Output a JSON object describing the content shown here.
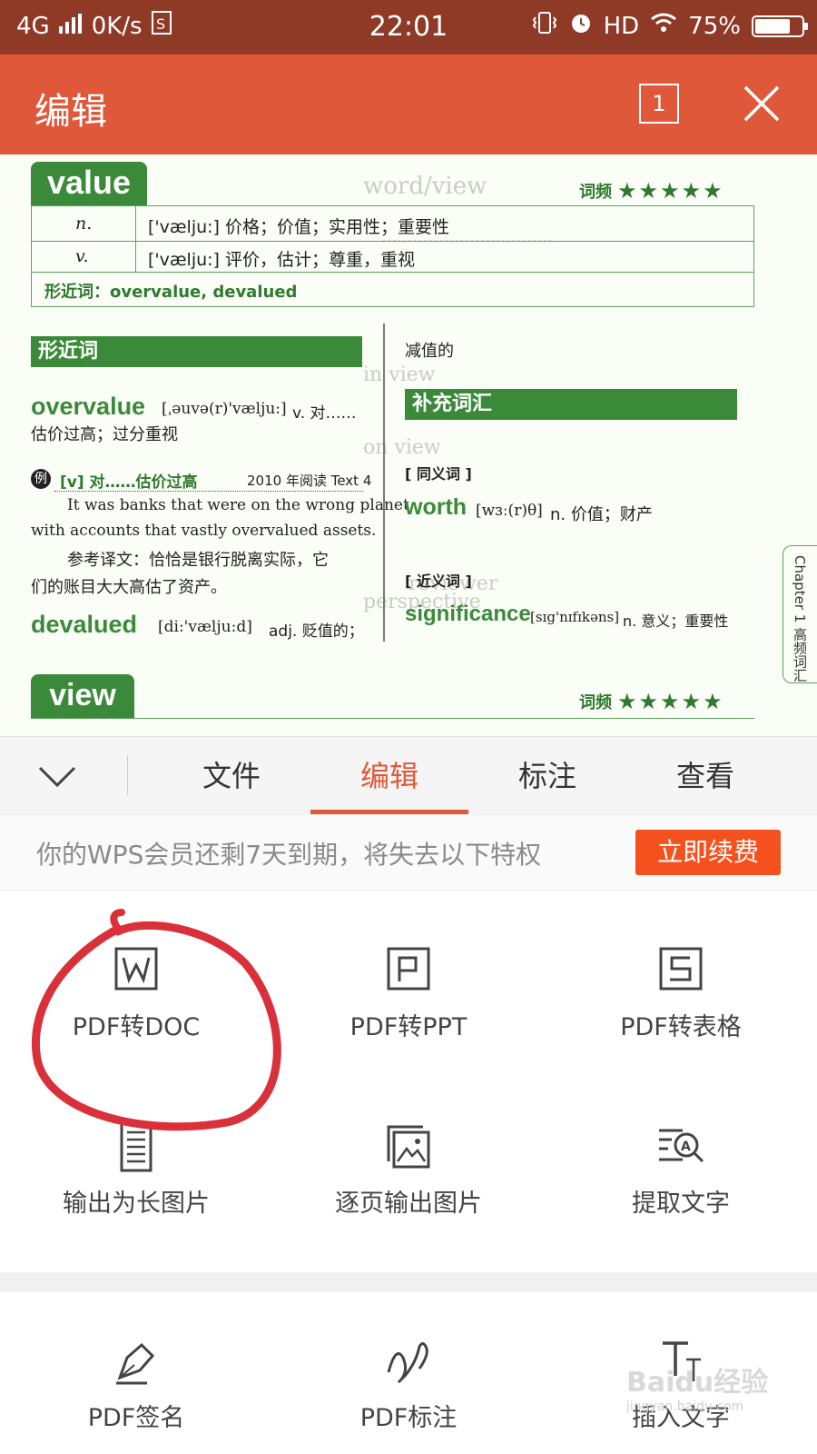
{
  "status_bar": {
    "network": "4G",
    "speed": "0K/s",
    "time": "22:01",
    "hd": "HD",
    "battery": "75%",
    "battery_level": 0.75
  },
  "app_bar": {
    "title": "编辑",
    "page_indicator": "1"
  },
  "document": {
    "entry1": {
      "word": "value",
      "frequency_label": "词频",
      "stars": "★★★★★",
      "senses": [
        {
          "pos": "n.",
          "text": "['vælju:] 价格；价值；实用性；重要性"
        },
        {
          "pos": "v.",
          "text": "['vælju:] 评价，估计；尊重，重视"
        }
      ],
      "similar_line": "形近词：overvalue, devalued"
    },
    "left_col": {
      "section_title": "形近词",
      "overvalue_word": "overvalue",
      "overvalue_phon": "[ˌəuvə(r)'vælju:]",
      "overvalue_pos": "v. 对……",
      "overvalue_def": "估价过高；过分重视",
      "example_badge": "例",
      "example_tag": "[v] 对……估价过高",
      "example_source": "2010 年阅读 Text 4",
      "example_en_1": "It was banks that were on the wrong planet,",
      "example_en_2": "with accounts that vastly overvalued assets.",
      "example_cn_1": "参考译文：恰恰是银行脱离实际，它",
      "example_cn_2": "们的账目大大高估了资产。",
      "devalued_word": "devalued",
      "devalued_phon": "[di:'vælju:d]",
      "devalued_pos": "adj. 贬值的；"
    },
    "right_col": {
      "cont": "减值的",
      "section_title": "补充词汇",
      "syn_label": "[ 同义词 ]",
      "worth_word": "worth",
      "worth_phon": "[wɜː(r)θ]",
      "worth_def": "n. 价值；财产",
      "near_label": "[ 近义词 ]",
      "sig_word": "significance",
      "sig_phon": "[sɪg'nɪfɪkəns]",
      "sig_def": "n. 意义；重要性"
    },
    "entry2": {
      "word": "view",
      "frequency_label": "词频",
      "stars": "★★★★★"
    },
    "chapter_tab": "Chapter 1 高频词汇"
  },
  "bottom_sheet": {
    "tabs": [
      {
        "label": "文件"
      },
      {
        "label": "编辑"
      },
      {
        "label": "标注"
      },
      {
        "label": "查看"
      }
    ],
    "promo": {
      "message": "你的WPS会员还剩7天到期，将失去以下特权",
      "button": "立即续费"
    },
    "tools": [
      {
        "label": "PDF转DOC",
        "icon": "word-doc-icon"
      },
      {
        "label": "PDF转PPT",
        "icon": "ppt-icon"
      },
      {
        "label": "PDF转表格",
        "icon": "sheet-icon"
      },
      {
        "label": "输出为长图片",
        "icon": "long-image-icon"
      },
      {
        "label": "逐页输出图片",
        "icon": "pages-image-icon"
      },
      {
        "label": "提取文字",
        "icon": "extract-text-icon"
      },
      {
        "label": "PDF签名",
        "icon": "pen-sign-icon"
      },
      {
        "label": "PDF标注",
        "icon": "scribble-icon"
      },
      {
        "label": "插入文字",
        "icon": "insert-text-icon"
      }
    ]
  },
  "watermark": {
    "text": "Baidu经验",
    "sub": "jingyan.baidu.com"
  },
  "colors": {
    "status_bar": "#8e3a27",
    "app_bar": "#e0583a",
    "accent": "#e0583a",
    "renew_button": "#f4511e",
    "dictionary_green": "#3b8a3a",
    "annotation_circle": "#d9303a"
  }
}
